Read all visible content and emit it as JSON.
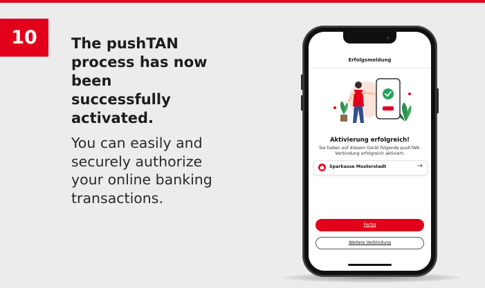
{
  "step": {
    "number": "10"
  },
  "instruction": {
    "heading": "The pushTAN process has now been successfully activated.",
    "body": "You can easily and securely authorize your online banking transactions."
  },
  "phone_screen": {
    "nav_title": "Erfolgsmeldung",
    "success_title": "Aktivierung erfolgreich!",
    "success_text": "Sie haben auf diesem Gerät folgende pushTAN-Verbindung erfolgreich aktiviert:",
    "connection": {
      "bank_name": "Sparkasse Musterstadt",
      "icon": "sparkasse-logo-icon",
      "arrow_icon": "arrow-right-icon"
    },
    "primary_button": "Fertig",
    "secondary_button": "Weitere Verbindung"
  },
  "colors": {
    "accent": "#e2001a",
    "background": "#ececec",
    "text": "#1c1c1c"
  }
}
